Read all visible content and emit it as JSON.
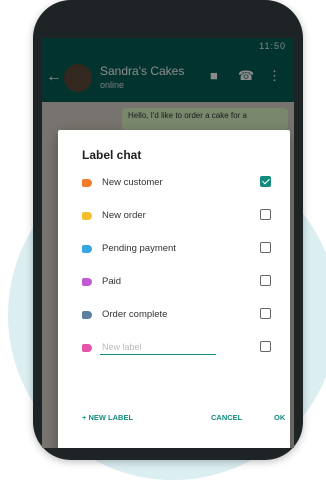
{
  "status_bar": {
    "time": "11:50"
  },
  "chat_header": {
    "contact_name": "Sandra's Cakes",
    "subtitle": "online"
  },
  "chat_preview": {
    "message": "Hello, I'd like to order a cake for a"
  },
  "dialog": {
    "title": "Label chat",
    "labels": [
      {
        "name": "New customer",
        "color": "#f07d2c",
        "checked": true
      },
      {
        "name": "New order",
        "color": "#f6c02c",
        "checked": false
      },
      {
        "name": "Pending payment",
        "color": "#35a6e0",
        "checked": false
      },
      {
        "name": "Paid",
        "color": "#c25ad3",
        "checked": false
      },
      {
        "name": "Order complete",
        "color": "#5b7fa0",
        "checked": false
      }
    ],
    "new_label_row": {
      "color": "#e755a8",
      "placeholder": "New label",
      "value": ""
    },
    "add_new_label": "+ NEW LABEL",
    "cancel_button": "CANCEL",
    "ok_button": "OK"
  }
}
